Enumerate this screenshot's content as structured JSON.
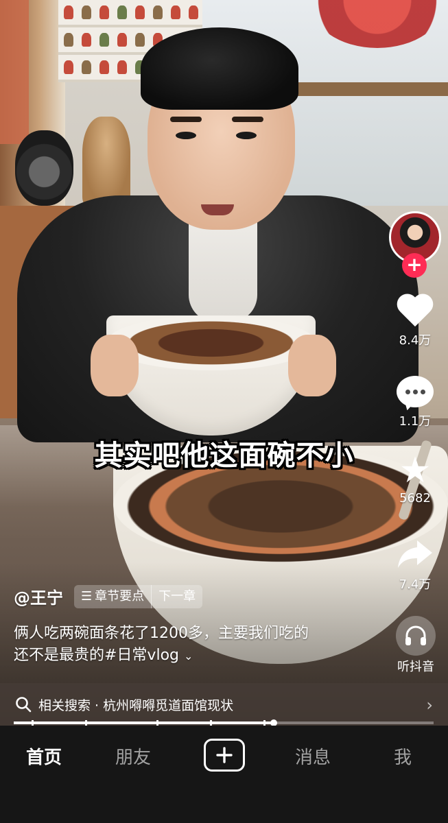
{
  "video": {
    "subtitle": "其实吧他这面碗不小"
  },
  "actions": {
    "like_count": "8.4万",
    "comment_count": "1.1万",
    "favorite_count": "5682",
    "share_count": "7.4万",
    "listen_label": "听抖音",
    "follow_symbol": "+",
    "accent_color": "#fe2c55"
  },
  "post": {
    "author": "@王宁",
    "chapter_points": "章节要点",
    "next_chapter": "下一章",
    "description_line1": "俩人吃两碗面条花了1200多，主要我们吃的",
    "description_line2": "还不是最贵的#日常vlog",
    "expand_icon": "chevron-down-icon"
  },
  "related_search": {
    "text": "相关搜索 · 杭州嘚嘚觅道面馆现状"
  },
  "progress": {
    "played_fraction": 0.62
  },
  "tabbar": {
    "home": "首页",
    "friends": "朋友",
    "messages": "消息",
    "me": "我"
  }
}
